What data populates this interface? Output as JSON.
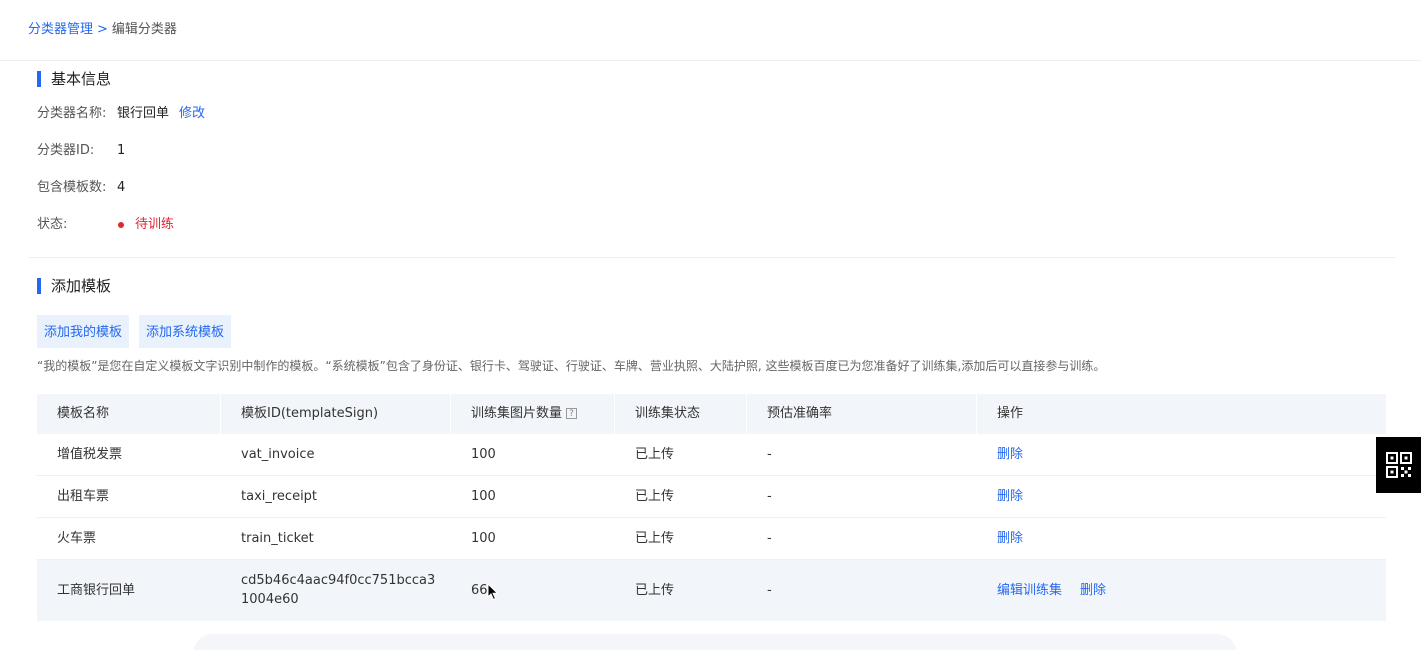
{
  "breadcrumb": {
    "parent": "分类器管理",
    "separator": ">",
    "current": "编辑分类器"
  },
  "basic_info": {
    "title": "基本信息",
    "name_label": "分类器名称:",
    "name_value": "银行回单",
    "edit_label": "修改",
    "id_label": "分类器ID:",
    "id_value": "1",
    "template_count_label": "包含模板数:",
    "template_count_value": "4",
    "status_label": "状态:",
    "status_value": "待训练",
    "status_color": "#e0262f"
  },
  "add_template": {
    "title": "添加模板",
    "btn_my": "添加我的模板",
    "btn_system": "添加系统模板",
    "hint": "“我的模板”是您在自定义模板文字识别中制作的模板。“系统模板”包含了身份证、银行卡、驾驶证、行驶证、车牌、营业执照、大陆护照,  这些模板百度已为您准备好了训练集,添加后可以直接参与训练。"
  },
  "table": {
    "headers": {
      "name": "模板名称",
      "sign": "模板ID(templateSign)",
      "count": "训练集图片数量",
      "count_help": "?",
      "state": "训练集状态",
      "accuracy": "预估准确率",
      "ops": "操作"
    },
    "rows": [
      {
        "name": "增值税发票",
        "sign": "vat_invoice",
        "count": "100",
        "state": "已上传",
        "accuracy": "-",
        "op_edit": "",
        "op_delete": "删除"
      },
      {
        "name": "出租车票",
        "sign": "taxi_receipt",
        "count": "100",
        "state": "已上传",
        "accuracy": "-",
        "op_edit": "",
        "op_delete": "删除"
      },
      {
        "name": "火车票",
        "sign": "train_ticket",
        "count": "100",
        "state": "已上传",
        "accuracy": "-",
        "op_edit": "",
        "op_delete": "删除"
      },
      {
        "name": "工商银行回单",
        "sign": "cd5b46c4aac94f0cc751bcca31004e60",
        "count": "66",
        "state": "已上传",
        "accuracy": "-",
        "op_edit": "编辑训练集",
        "op_delete": "删除"
      }
    ]
  },
  "colors": {
    "accent": "#2468f2",
    "button_bg": "#e8f1fc",
    "header_bg": "#f2f5f9"
  },
  "icons": {
    "floating": "qr-code-icon",
    "cursor": "mouse-pointer-icon"
  }
}
